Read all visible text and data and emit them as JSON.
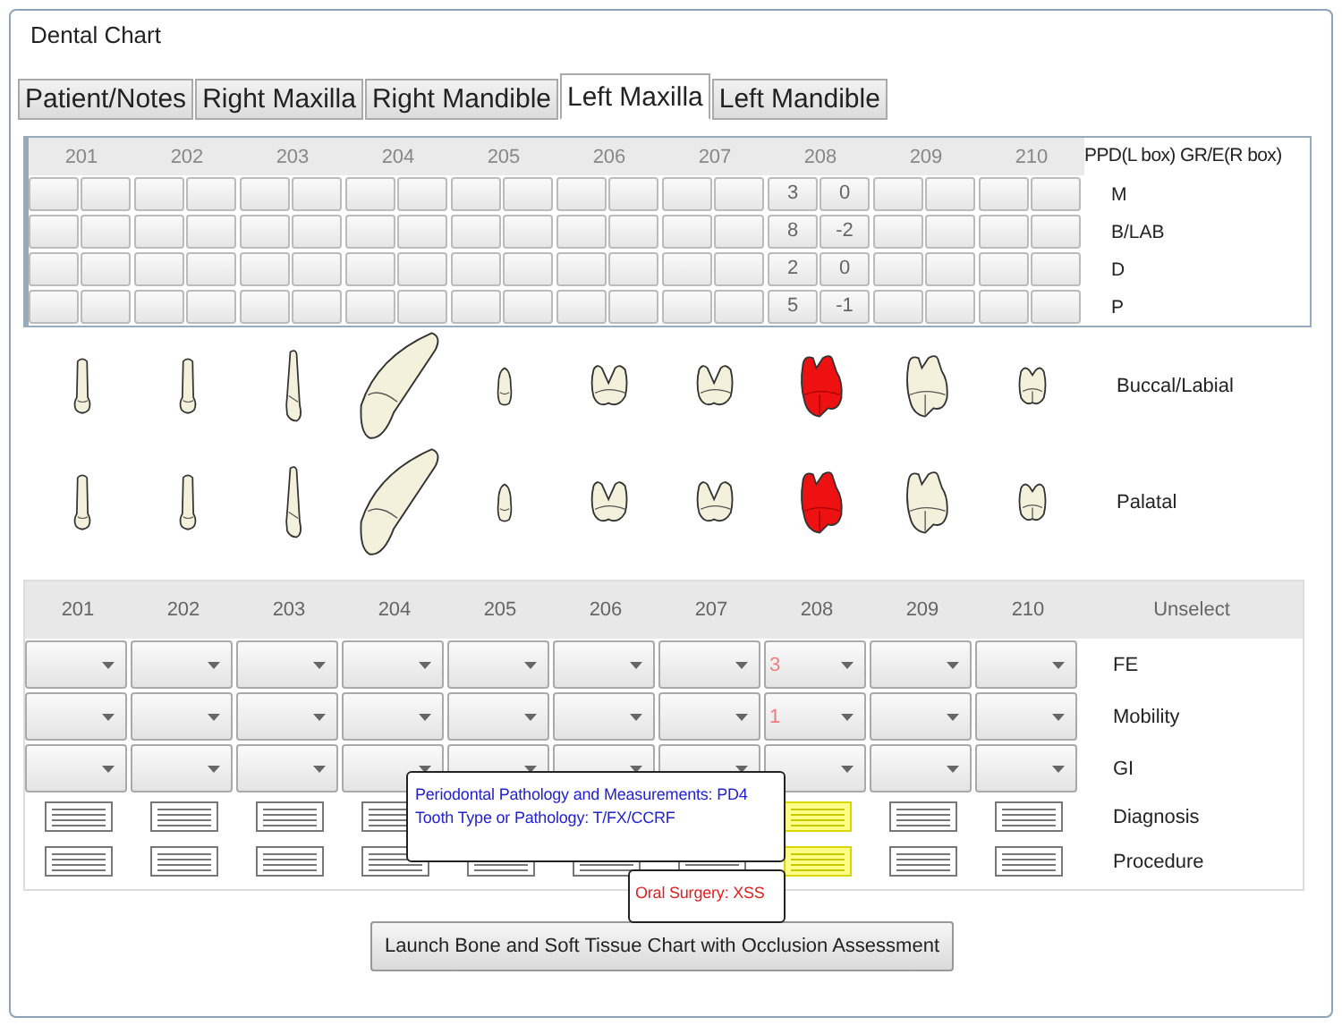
{
  "window": {
    "title": "Dental Chart"
  },
  "tabs": [
    {
      "label": "Patient/Notes",
      "selected": false
    },
    {
      "label": "Right Maxilla",
      "selected": false
    },
    {
      "label": "Right Mandible",
      "selected": false
    },
    {
      "label": "Left Maxilla",
      "selected": true
    },
    {
      "label": "Left Mandible",
      "selected": false
    }
  ],
  "perio": {
    "header_label": "PPD(L box) GR/E(R box)",
    "sites": [
      "M",
      "B/LAB",
      "D",
      "P"
    ],
    "teeth": [
      {
        "number": "201"
      },
      {
        "number": "202"
      },
      {
        "number": "203"
      },
      {
        "number": "204"
      },
      {
        "number": "205"
      },
      {
        "number": "206"
      },
      {
        "number": "207"
      },
      {
        "number": "208",
        "readings": [
          {
            "ppd": "3",
            "gr": "0"
          },
          {
            "ppd": "8",
            "gr": "-2"
          },
          {
            "ppd": "2",
            "gr": "0"
          },
          {
            "ppd": "5",
            "gr": "-1"
          }
        ]
      },
      {
        "number": "209"
      },
      {
        "number": "210"
      }
    ]
  },
  "views": [
    {
      "label": "Buccal/Labial"
    },
    {
      "label": "Palatal"
    }
  ],
  "teeth": [
    {
      "kind": "slim",
      "affected": false
    },
    {
      "kind": "slim",
      "affected": false
    },
    {
      "kind": "long",
      "affected": false
    },
    {
      "kind": "curved",
      "affected": false
    },
    {
      "kind": "small",
      "affected": false
    },
    {
      "kind": "bicusp",
      "affected": false
    },
    {
      "kind": "bicusp",
      "affected": false
    },
    {
      "kind": "molar",
      "affected": true
    },
    {
      "kind": "molar",
      "affected": false
    },
    {
      "kind": "small_molar",
      "affected": false
    }
  ],
  "assessment": {
    "numbers": [
      "201",
      "202",
      "203",
      "204",
      "205",
      "206",
      "207",
      "208",
      "209",
      "210"
    ],
    "unselect": "Unselect",
    "rows": [
      {
        "label": "FE",
        "kind": "dropdown",
        "cells": [
          {},
          {},
          {},
          {},
          {},
          {},
          {},
          {
            "value": "3"
          },
          {},
          {}
        ]
      },
      {
        "label": "Mobility",
        "kind": "dropdown",
        "cells": [
          {},
          {},
          {},
          {},
          {},
          {},
          {},
          {
            "value": "1"
          },
          {},
          {}
        ]
      },
      {
        "label": "GI",
        "kind": "dropdown",
        "cells": [
          {},
          {},
          {},
          {},
          {},
          {},
          {},
          {},
          {},
          {}
        ]
      },
      {
        "label": "Diagnosis",
        "kind": "notes",
        "cells": [
          {
            "highlighted": false
          },
          {
            "highlighted": false
          },
          {
            "highlighted": false
          },
          {
            "highlighted": false
          },
          {},
          {},
          {},
          {
            "highlighted": true
          },
          {
            "highlighted": false
          },
          {
            "highlighted": false
          }
        ]
      },
      {
        "label": "Procedure",
        "kind": "notes",
        "cells": [
          {
            "highlighted": false
          },
          {
            "highlighted": false
          },
          {
            "highlighted": false
          },
          {
            "highlighted": false
          },
          {
            "highlighted": false
          },
          {
            "highlighted": false
          },
          {
            "highlighted": false
          },
          {
            "highlighted": true
          },
          {
            "highlighted": false
          },
          {
            "highlighted": false
          }
        ]
      }
    ]
  },
  "tooltips": [
    {
      "kind": "pathology",
      "lines": [
        "Periodontal Pathology and Measurements:  PD4",
        "Tooth Type or Pathology:  T/FX/CCRF"
      ]
    },
    {
      "kind": "surgery",
      "lines": [
        "Oral Surgery:  XSS"
      ]
    }
  ],
  "launch_button": "Launch Bone and Soft Tissue Chart with Occlusion Assessment"
}
